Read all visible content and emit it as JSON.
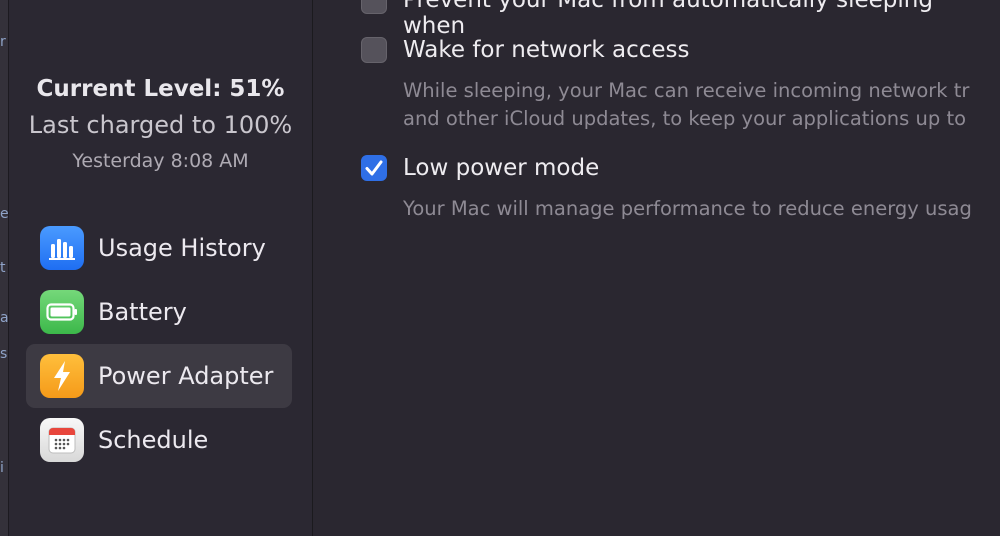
{
  "status": {
    "current_level": "Current Level: 51%",
    "last_charged": "Last charged to 100%",
    "timestamp": "Yesterday 8:08 AM"
  },
  "sidebar": {
    "items": [
      {
        "label": "Usage History",
        "icon": "bar-chart-icon",
        "selected": false
      },
      {
        "label": "Battery",
        "icon": "battery-icon",
        "selected": false
      },
      {
        "label": "Power Adapter",
        "icon": "lightning-icon",
        "selected": true
      },
      {
        "label": "Schedule",
        "icon": "calendar-icon",
        "selected": false
      }
    ]
  },
  "options": {
    "prevent_sleep": {
      "label": "Prevent your Mac from automatically sleeping when",
      "checked": false
    },
    "wake_network": {
      "label": "Wake for network access",
      "checked": false,
      "desc_line1": "While sleeping, your Mac can receive incoming network tr",
      "desc_line2": "and other iCloud updates, to keep your applications up to"
    },
    "low_power": {
      "label": "Low power mode",
      "checked": true,
      "desc": "Your Mac will manage performance to reduce energy usag"
    }
  },
  "colors": {
    "accent": "#2f6fe6",
    "selected_bg": "#3d3a43"
  }
}
